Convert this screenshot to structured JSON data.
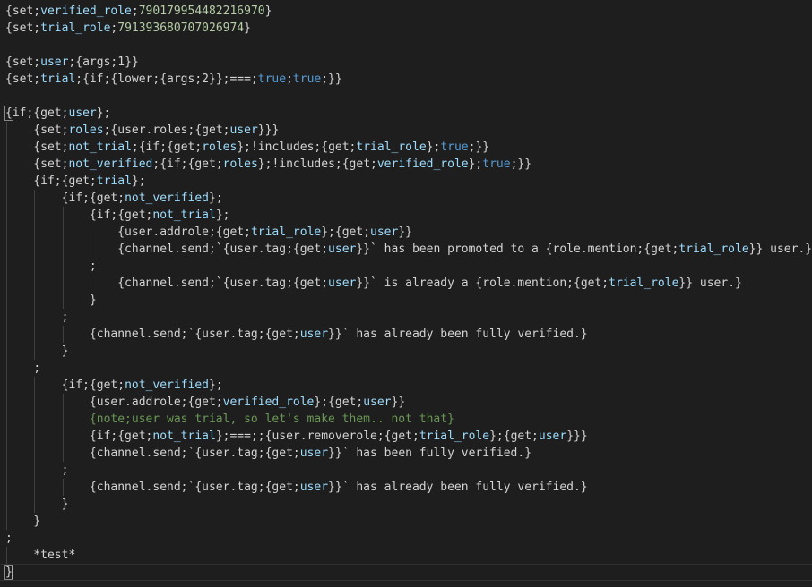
{
  "editor": {
    "lines": [
      {
        "indent": 0,
        "tokens": [
          [
            "{set;",
            "name"
          ],
          [
            "verified_role",
            "var"
          ],
          [
            ";",
            "punct"
          ],
          [
            "790179954482216970",
            "num"
          ],
          [
            "}",
            "punct"
          ]
        ]
      },
      {
        "indent": 0,
        "tokens": [
          [
            "{set;",
            "name"
          ],
          [
            "trial_role",
            "var"
          ],
          [
            ";",
            "punct"
          ],
          [
            "791393680707026974",
            "num"
          ],
          [
            "}",
            "punct"
          ]
        ]
      },
      {
        "indent": 0,
        "tokens": []
      },
      {
        "indent": 0,
        "tokens": [
          [
            "{set;",
            "name"
          ],
          [
            "user",
            "var"
          ],
          [
            ";{args;1}}",
            "punct"
          ]
        ]
      },
      {
        "indent": 0,
        "tokens": [
          [
            "{set;",
            "name"
          ],
          [
            "trial",
            "var"
          ],
          [
            ";{if;{lower;{args;2}};===;",
            "punct"
          ],
          [
            "true",
            "bool"
          ],
          [
            ";",
            "punct"
          ],
          [
            "true",
            "bool"
          ],
          [
            ";}}",
            "punct"
          ]
        ]
      },
      {
        "indent": 0,
        "tokens": []
      },
      {
        "indent": 0,
        "tokens": [
          [
            "{",
            "match"
          ],
          [
            "if;{get;",
            "name"
          ],
          [
            "user",
            "var"
          ],
          [
            "};",
            "punct"
          ]
        ]
      },
      {
        "indent": 1,
        "tokens": [
          [
            "{set;",
            "name"
          ],
          [
            "roles",
            "var"
          ],
          [
            ";{user.roles;{get;",
            "punct"
          ],
          [
            "user",
            "var"
          ],
          [
            "}}}",
            "punct"
          ]
        ]
      },
      {
        "indent": 1,
        "tokens": [
          [
            "{set;",
            "name"
          ],
          [
            "not_trial",
            "var"
          ],
          [
            ";{if;{get;",
            "punct"
          ],
          [
            "roles",
            "var"
          ],
          [
            "};!includes;{get;",
            "punct"
          ],
          [
            "trial_role",
            "var"
          ],
          [
            "};",
            "punct"
          ],
          [
            "true",
            "bool"
          ],
          [
            ";}}",
            "punct"
          ]
        ]
      },
      {
        "indent": 1,
        "tokens": [
          [
            "{set;",
            "name"
          ],
          [
            "not_verified",
            "var"
          ],
          [
            ";{if;{get;",
            "punct"
          ],
          [
            "roles",
            "var"
          ],
          [
            "};!includes;{get;",
            "punct"
          ],
          [
            "verified_role",
            "var"
          ],
          [
            "};",
            "punct"
          ],
          [
            "true",
            "bool"
          ],
          [
            ";}}",
            "punct"
          ]
        ]
      },
      {
        "indent": 1,
        "tokens": [
          [
            "{if;{get;",
            "name"
          ],
          [
            "trial",
            "var"
          ],
          [
            "};",
            "punct"
          ]
        ]
      },
      {
        "indent": 2,
        "tokens": [
          [
            "{if;{get;",
            "name"
          ],
          [
            "not_verified",
            "var"
          ],
          [
            "};",
            "punct"
          ]
        ]
      },
      {
        "indent": 3,
        "tokens": [
          [
            "{if;{get;",
            "name"
          ],
          [
            "not_trial",
            "var"
          ],
          [
            "};",
            "punct"
          ]
        ]
      },
      {
        "indent": 4,
        "tokens": [
          [
            "{user.addrole;{get;",
            "name"
          ],
          [
            "trial_role",
            "var"
          ],
          [
            "};{get;",
            "punct"
          ],
          [
            "user",
            "var"
          ],
          [
            "}}",
            "punct"
          ]
        ]
      },
      {
        "indent": 4,
        "tokens": [
          [
            "{channel.send;`{user.tag;{get;",
            "name"
          ],
          [
            "user",
            "var"
          ],
          [
            "}}` has been promoted to a {role.mention;{get;",
            "punct"
          ],
          [
            "trial_role",
            "var"
          ],
          [
            "}} user.}",
            "punct"
          ]
        ]
      },
      {
        "indent": 3,
        "tokens": [
          [
            ";",
            "punct"
          ]
        ]
      },
      {
        "indent": 4,
        "tokens": [
          [
            "{channel.send;`{user.tag;{get;",
            "name"
          ],
          [
            "user",
            "var"
          ],
          [
            "}}` is already a {role.mention;{get;",
            "punct"
          ],
          [
            "trial_role",
            "var"
          ],
          [
            "}} user.}",
            "punct"
          ]
        ]
      },
      {
        "indent": 3,
        "tokens": [
          [
            "}",
            "punct"
          ]
        ]
      },
      {
        "indent": 2,
        "tokens": [
          [
            ";",
            "punct"
          ]
        ]
      },
      {
        "indent": 3,
        "tokens": [
          [
            "{channel.send;`{user.tag;{get;",
            "name"
          ],
          [
            "user",
            "var"
          ],
          [
            "}}` has already been fully verified.}",
            "punct"
          ]
        ]
      },
      {
        "indent": 2,
        "tokens": [
          [
            "}",
            "punct"
          ]
        ]
      },
      {
        "indent": 1,
        "tokens": [
          [
            ";",
            "punct"
          ]
        ]
      },
      {
        "indent": 2,
        "tokens": [
          [
            "{if;{get;",
            "name"
          ],
          [
            "not_verified",
            "var"
          ],
          [
            "};",
            "punct"
          ]
        ]
      },
      {
        "indent": 3,
        "tokens": [
          [
            "{user.addrole;{get;",
            "name"
          ],
          [
            "verified_role",
            "var"
          ],
          [
            "};{get;",
            "punct"
          ],
          [
            "user",
            "var"
          ],
          [
            "}}",
            "punct"
          ]
        ]
      },
      {
        "indent": 3,
        "tokens": [
          [
            "{note;user was trial, so let's make them.. not that}",
            "comment"
          ]
        ]
      },
      {
        "indent": 3,
        "tokens": [
          [
            "{if;{get;",
            "name"
          ],
          [
            "not_trial",
            "var"
          ],
          [
            "};===;;{user.removerole;{get;",
            "punct"
          ],
          [
            "trial_role",
            "var"
          ],
          [
            "};{get;",
            "punct"
          ],
          [
            "user",
            "var"
          ],
          [
            "}}}",
            "punct"
          ]
        ]
      },
      {
        "indent": 3,
        "tokens": [
          [
            "{channel.send;`{user.tag;{get;",
            "name"
          ],
          [
            "user",
            "var"
          ],
          [
            "}}` has been fully verified.}",
            "punct"
          ]
        ]
      },
      {
        "indent": 2,
        "tokens": [
          [
            ";",
            "punct"
          ]
        ]
      },
      {
        "indent": 3,
        "tokens": [
          [
            "{channel.send;`{user.tag;{get;",
            "name"
          ],
          [
            "user",
            "var"
          ],
          [
            "}}` has already been fully verified.}",
            "punct"
          ]
        ]
      },
      {
        "indent": 2,
        "tokens": [
          [
            "}",
            "punct"
          ]
        ]
      },
      {
        "indent": 1,
        "tokens": [
          [
            "}",
            "punct"
          ]
        ]
      },
      {
        "indent": 0,
        "tokens": [
          [
            ";",
            "punct"
          ]
        ]
      },
      {
        "indent": 1,
        "tokens": [
          [
            "*test*",
            "name"
          ]
        ]
      },
      {
        "indent": 0,
        "tokens": [
          [
            "}",
            "match"
          ]
        ],
        "cursor": true,
        "current": true
      }
    ],
    "colors": {
      "background": "#1e1e1e",
      "text": "#d4d4d4",
      "variable": "#9cdcfe",
      "number": "#b5cea8",
      "boolean": "#569cd6",
      "comment": "#6a9955",
      "indent_guide": "#404040"
    }
  }
}
